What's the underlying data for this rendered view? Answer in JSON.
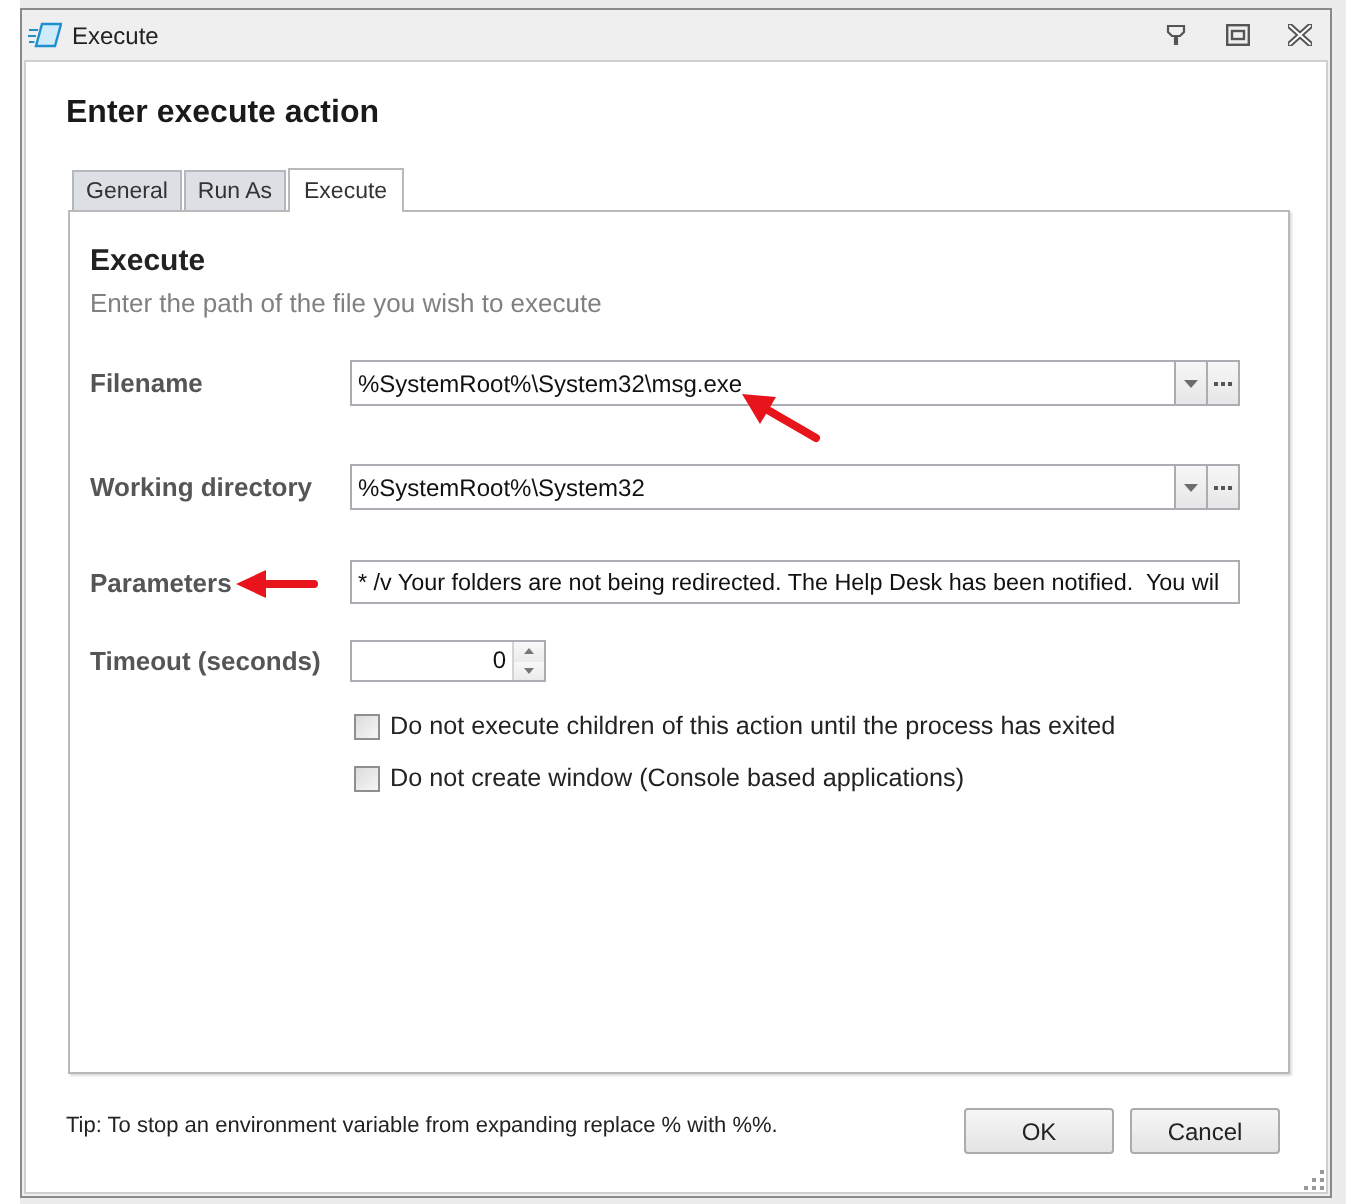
{
  "window": {
    "title": "Execute"
  },
  "heading": "Enter execute action",
  "tabs": [
    {
      "label": "General",
      "selected": false
    },
    {
      "label": "Run As",
      "selected": false
    },
    {
      "label": "Execute",
      "selected": true
    }
  ],
  "panel": {
    "title": "Execute",
    "description": "Enter the path of the file you wish to execute"
  },
  "fields": [
    {
      "kind": "combo",
      "label": "Filename",
      "value": "%SystemRoot%\\System32\\msg.exe",
      "value_arrow": true,
      "label_arrow": false
    },
    {
      "kind": "combo",
      "label": "Working directory",
      "value": "%SystemRoot%\\System32",
      "value_arrow": false,
      "label_arrow": false
    },
    {
      "kind": "text",
      "label": "Parameters",
      "value": "* /v Your folders are not being redirected. The Help Desk has been notified.  You wil",
      "value_arrow": false,
      "label_arrow": true
    },
    {
      "kind": "spin",
      "label": "Timeout (seconds)",
      "value": "0",
      "value_arrow": false,
      "label_arrow": false
    }
  ],
  "options": [
    {
      "label": "Do not execute children of this action until the process has exited",
      "checked": false
    },
    {
      "label": "Do not create window (Console based applications)",
      "checked": false
    }
  ],
  "tip": "Tip: To stop an environment variable from expanding replace % with %%.",
  "buttons": [
    "OK",
    "Cancel"
  ]
}
